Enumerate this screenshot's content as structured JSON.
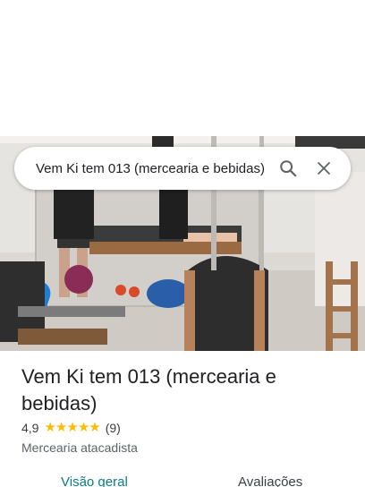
{
  "search": {
    "query": "Vem Ki tem 013 (mercearia e bebidas)"
  },
  "place": {
    "title": "Vem Ki tem 013 (mercearia e bebidas)",
    "rating": "4,9",
    "stars": 5,
    "review_count": "(9)",
    "category": "Mercearia atacadista"
  },
  "tabs": [
    {
      "label": "Visão geral",
      "active": true
    },
    {
      "label": "Avaliações",
      "active": false
    }
  ],
  "colors": {
    "accent": "#0b7b85",
    "star": "#fbbc04"
  }
}
